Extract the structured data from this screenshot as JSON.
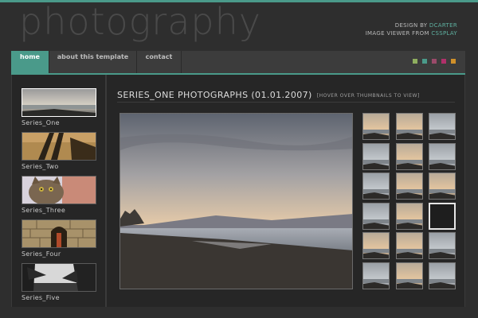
{
  "site": {
    "logo": "photography",
    "credits": {
      "line1_prefix": "DESIGN BY",
      "line1_link": "DCARTER",
      "line2_prefix": "IMAGE VIEWER FROM",
      "line2_link": "CSSPLAY"
    }
  },
  "nav": {
    "tabs": [
      {
        "label": "home",
        "active": true
      },
      {
        "label": "about this template",
        "active": false
      },
      {
        "label": "contact",
        "active": false
      }
    ],
    "swatches": [
      "#8fae5f",
      "#4a9a8a",
      "#9a4a6a",
      "#b0306a",
      "#d0902a"
    ]
  },
  "sidebar": {
    "series": [
      {
        "label": "Series_One",
        "active": true,
        "icon": "seascape-thumbnail"
      },
      {
        "label": "Series_Two",
        "active": false,
        "icon": "shadows-thumbnail"
      },
      {
        "label": "Series_Three",
        "active": false,
        "icon": "cat-thumbnail"
      },
      {
        "label": "Series_Four",
        "active": false,
        "icon": "stone-arch-thumbnail"
      },
      {
        "label": "Series_Five",
        "active": false,
        "icon": "trees-thumbnail"
      }
    ]
  },
  "content": {
    "title": "SERIES_ONE PHOTOGRAPHS (01.01.2007)",
    "hint": "[HOVER OVER THUMBNAILS TO VIEW]"
  },
  "gallery": {
    "rows": 6,
    "cols": 3,
    "selected_index": 11
  }
}
